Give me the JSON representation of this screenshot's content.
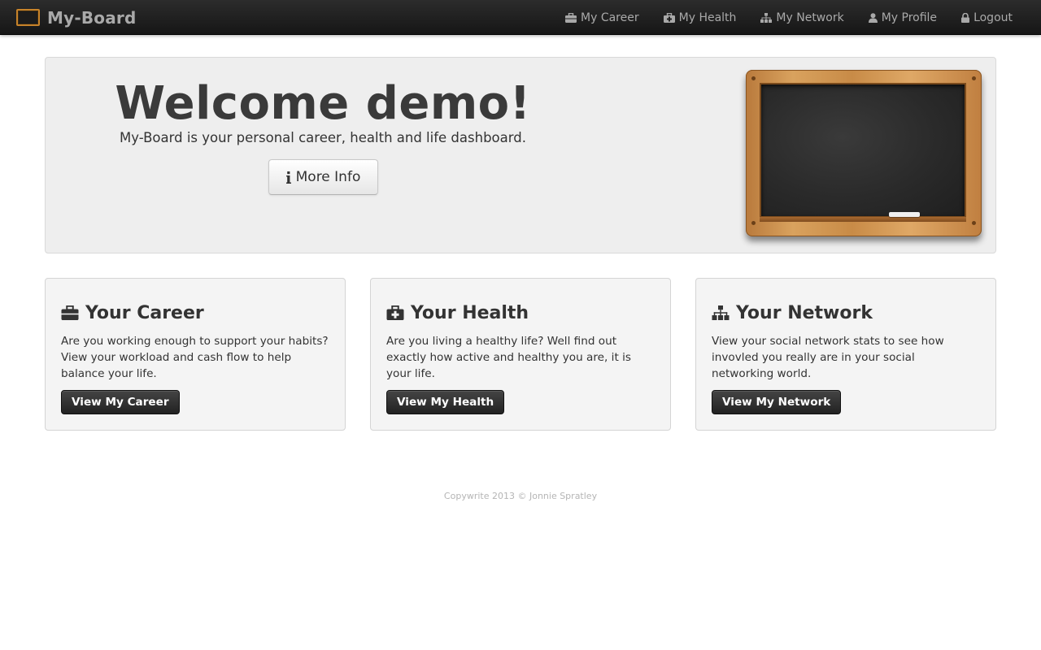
{
  "brand": {
    "name": "My-Board",
    "icon": "chalkboard-icon",
    "accent_color": "#c7832a"
  },
  "nav": {
    "items": [
      {
        "label": "My Career",
        "icon": "briefcase-icon"
      },
      {
        "label": "My Health",
        "icon": "medkit-icon"
      },
      {
        "label": "My Network",
        "icon": "sitemap-icon"
      },
      {
        "label": "My Profile",
        "icon": "user-icon"
      },
      {
        "label": "Logout",
        "icon": "lock-icon"
      }
    ]
  },
  "hero": {
    "title": "Welcome demo!",
    "subtitle": "My-Board is your personal career, health and life dashboard.",
    "button_label": "More Info",
    "button_icon": "info-icon",
    "image": "chalkboard-illustration"
  },
  "cards": [
    {
      "title": "Your Career",
      "icon": "briefcase-icon",
      "text": "Are you working enough to support your habits? View your workload and cash flow to help balance your life.",
      "button_label": "View My Career"
    },
    {
      "title": "Your Health",
      "icon": "medkit-icon",
      "text": "Are you living a healthy life? Well find out exactly how active and healthy you are, it is your life.",
      "button_label": "View My Health"
    },
    {
      "title": "Your Network",
      "icon": "sitemap-icon",
      "text": "View your social network stats to see how invovled you really are in your social networking world.",
      "button_label": "View My Network"
    }
  ],
  "footer": {
    "text": "Copywrite 2013 © Jonnie Spratley"
  },
  "colors": {
    "navbar_bg": "#1f1f1f",
    "nav_text": "#a9a9a9",
    "hero_bg": "#eeeeee",
    "card_bg": "#f4f4f4",
    "dark_button": "#333333",
    "footer_text": "#b5b5b5"
  }
}
